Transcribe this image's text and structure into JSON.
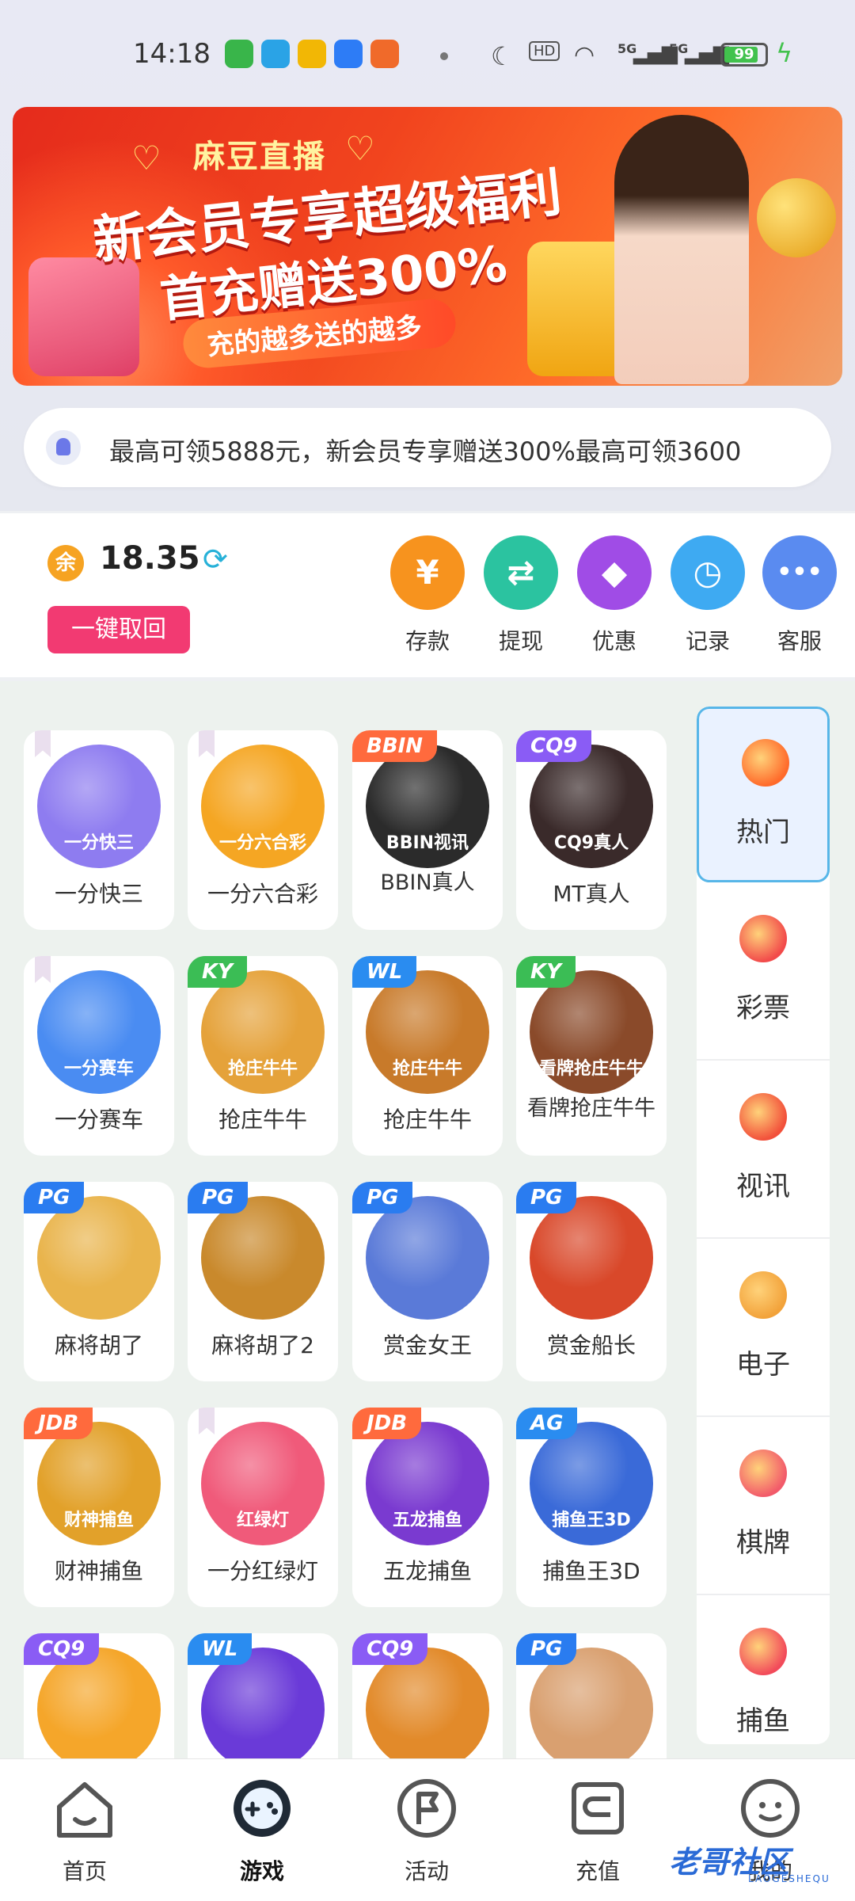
{
  "status_bar": {
    "time": "14:18",
    "hd_label": "HD",
    "signal1_label": "5G",
    "signal2_label": "5G",
    "battery": "99",
    "app_icons": [
      "wechat-like-icon",
      "telegram-icon",
      "video-app-icon",
      "blue-app-icon",
      "orange-app-icon"
    ]
  },
  "banner": {
    "brand": "麻豆直播",
    "line1": "新会员专享超级福利",
    "line2": "首充赠送300%",
    "line3": "充的越多送的越多",
    "active_dot": 0,
    "dot_count": 4
  },
  "marquee": {
    "text": "最高可领5888元，新会员专享赠送300%最高可领3600"
  },
  "wallet": {
    "balance_badge": "余",
    "balance": "18.35",
    "recall_button": "一键取回"
  },
  "quick_actions": [
    {
      "label": "存款",
      "icon": "yen-icon",
      "color": "#f7931e",
      "glyph": "¥"
    },
    {
      "label": "提现",
      "icon": "transfer-icon",
      "color": "#2bc3a0",
      "glyph": "⇄"
    },
    {
      "label": "优惠",
      "icon": "tag-icon",
      "color": "#a04ce6",
      "glyph": "◆"
    },
    {
      "label": "记录",
      "icon": "clock-icon",
      "color": "#3eaaf2",
      "glyph": "◷"
    },
    {
      "label": "客服",
      "icon": "chat-icon",
      "color": "#5a8bf0",
      "glyph": "•••"
    }
  ],
  "games": [
    {
      "name": "一分快三",
      "tag": "",
      "ribbon": true,
      "caption": "一分快三",
      "color": "#8e7cf0"
    },
    {
      "name": "一分六合彩",
      "tag": "",
      "ribbon": true,
      "caption": "一分六合彩",
      "color": "#f5a623"
    },
    {
      "name": "BBIN真人",
      "tag": "BBIN",
      "tag_color": "#ff6a3d",
      "ribbon": false,
      "caption": "BBIN视讯",
      "color": "#2b2b2b"
    },
    {
      "name": "MT真人",
      "tag": "CQ9",
      "tag_color": "#8a5cf5",
      "ribbon": false,
      "caption": "CQ9真人",
      "color": "#3a2a2a"
    },
    {
      "name": "一分赛车",
      "tag": "",
      "ribbon": true,
      "caption": "一分赛车",
      "color": "#4a8cf2"
    },
    {
      "name": "抢庄牛牛",
      "tag": "KY",
      "tag_color": "#3bbd55",
      "ribbon": false,
      "caption": "抢庄牛牛",
      "color": "#e5a23a"
    },
    {
      "name": "抢庄牛牛",
      "tag": "WL",
      "tag_color": "#2a8cf0",
      "ribbon": false,
      "caption": "抢庄牛牛",
      "color": "#c87a2a"
    },
    {
      "name": "看牌抢庄牛牛",
      "tag": "KY",
      "tag_color": "#3bbd55",
      "ribbon": false,
      "caption": "看牌抢庄牛牛",
      "color": "#8a4a2a"
    },
    {
      "name": "麻将胡了",
      "tag": "PG",
      "tag_color": "#2a7cf0",
      "ribbon": false,
      "caption": "",
      "color": "#e9b44c"
    },
    {
      "name": "麻将胡了2",
      "tag": "PG",
      "tag_color": "#2a7cf0",
      "ribbon": false,
      "caption": "",
      "color": "#c9892c"
    },
    {
      "name": "赏金女王",
      "tag": "PG",
      "tag_color": "#2a7cf0",
      "ribbon": false,
      "caption": "",
      "color": "#5a7ad8"
    },
    {
      "name": "赏金船长",
      "tag": "PG",
      "tag_color": "#2a7cf0",
      "ribbon": false,
      "caption": "",
      "color": "#d9482a"
    },
    {
      "name": "财神捕鱼",
      "tag": "JDB",
      "tag_color": "#ff6a3d",
      "ribbon": false,
      "caption": "财神捕鱼",
      "color": "#e2a12a"
    },
    {
      "name": "一分红绿灯",
      "tag": "",
      "ribbon": true,
      "caption": "红绿灯",
      "color": "#f05a7a"
    },
    {
      "name": "五龙捕鱼",
      "tag": "JDB",
      "tag_color": "#ff6a3d",
      "ribbon": false,
      "caption": "五龙捕鱼",
      "color": "#7a3ad0"
    },
    {
      "name": "捕鱼王3D",
      "tag": "AG",
      "tag_color": "#2a8cf0",
      "ribbon": false,
      "caption": "捕鱼王3D",
      "color": "#3a6ad8"
    },
    {
      "name": "",
      "tag": "CQ9",
      "tag_color": "#8a5cf5",
      "ribbon": false,
      "caption": "",
      "color": "#f5a62a"
    },
    {
      "name": "",
      "tag": "WL",
      "tag_color": "#2a8cf0",
      "ribbon": false,
      "caption": "",
      "color": "#6a3ad8"
    },
    {
      "name": "",
      "tag": "CQ9",
      "tag_color": "#8a5cf5",
      "ribbon": false,
      "caption": "",
      "color": "#e28a2a"
    },
    {
      "name": "",
      "tag": "PG",
      "tag_color": "#2a7cf0",
      "ribbon": false,
      "caption": "",
      "color": "#d9a070"
    }
  ],
  "categories": [
    {
      "label": "热门",
      "icon": "fire-icon",
      "color": "#ff6a2a",
      "active": true
    },
    {
      "label": "彩票",
      "icon": "lottery-ball-icon",
      "color": "#f24a4a",
      "active": false
    },
    {
      "label": "视讯",
      "icon": "chip-icon",
      "color": "#f2503a",
      "active": false
    },
    {
      "label": "电子",
      "icon": "slot-seven-icon",
      "color": "#f2a23a",
      "active": false
    },
    {
      "label": "棋牌",
      "icon": "cards-icon",
      "color": "#f25a6a",
      "active": false
    },
    {
      "label": "捕鱼",
      "icon": "fish-icon",
      "color": "#f24a5a",
      "active": false
    }
  ],
  "nav": [
    {
      "label": "首页",
      "icon": "home-icon",
      "active": false
    },
    {
      "label": "游戏",
      "icon": "gamepad-icon",
      "active": true
    },
    {
      "label": "活动",
      "icon": "flag-icon",
      "active": false
    },
    {
      "label": "充值",
      "icon": "wallet-icon",
      "active": false
    },
    {
      "label": "我的",
      "icon": "profile-icon",
      "active": false
    }
  ],
  "watermark": {
    "text": "老哥社区",
    "sub": "LAOGESHEQU"
  }
}
